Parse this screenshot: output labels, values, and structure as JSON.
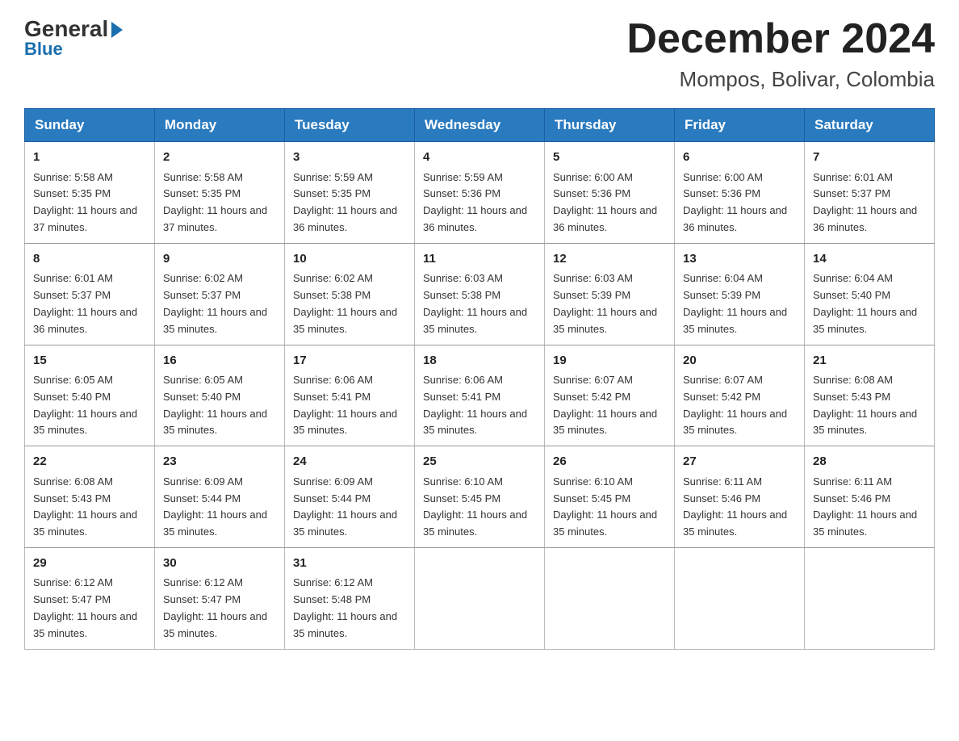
{
  "header": {
    "logo_general": "General",
    "logo_blue": "Blue",
    "month_title": "December 2024",
    "location": "Mompos, Bolivar, Colombia"
  },
  "days_of_week": [
    "Sunday",
    "Monday",
    "Tuesday",
    "Wednesday",
    "Thursday",
    "Friday",
    "Saturday"
  ],
  "weeks": [
    [
      {
        "day": "1",
        "sunrise": "5:58 AM",
        "sunset": "5:35 PM",
        "daylight": "11 hours and 37 minutes"
      },
      {
        "day": "2",
        "sunrise": "5:58 AM",
        "sunset": "5:35 PM",
        "daylight": "11 hours and 37 minutes"
      },
      {
        "day": "3",
        "sunrise": "5:59 AM",
        "sunset": "5:35 PM",
        "daylight": "11 hours and 36 minutes"
      },
      {
        "day": "4",
        "sunrise": "5:59 AM",
        "sunset": "5:36 PM",
        "daylight": "11 hours and 36 minutes"
      },
      {
        "day": "5",
        "sunrise": "6:00 AM",
        "sunset": "5:36 PM",
        "daylight": "11 hours and 36 minutes"
      },
      {
        "day": "6",
        "sunrise": "6:00 AM",
        "sunset": "5:36 PM",
        "daylight": "11 hours and 36 minutes"
      },
      {
        "day": "7",
        "sunrise": "6:01 AM",
        "sunset": "5:37 PM",
        "daylight": "11 hours and 36 minutes"
      }
    ],
    [
      {
        "day": "8",
        "sunrise": "6:01 AM",
        "sunset": "5:37 PM",
        "daylight": "11 hours and 36 minutes"
      },
      {
        "day": "9",
        "sunrise": "6:02 AM",
        "sunset": "5:37 PM",
        "daylight": "11 hours and 35 minutes"
      },
      {
        "day": "10",
        "sunrise": "6:02 AM",
        "sunset": "5:38 PM",
        "daylight": "11 hours and 35 minutes"
      },
      {
        "day": "11",
        "sunrise": "6:03 AM",
        "sunset": "5:38 PM",
        "daylight": "11 hours and 35 minutes"
      },
      {
        "day": "12",
        "sunrise": "6:03 AM",
        "sunset": "5:39 PM",
        "daylight": "11 hours and 35 minutes"
      },
      {
        "day": "13",
        "sunrise": "6:04 AM",
        "sunset": "5:39 PM",
        "daylight": "11 hours and 35 minutes"
      },
      {
        "day": "14",
        "sunrise": "6:04 AM",
        "sunset": "5:40 PM",
        "daylight": "11 hours and 35 minutes"
      }
    ],
    [
      {
        "day": "15",
        "sunrise": "6:05 AM",
        "sunset": "5:40 PM",
        "daylight": "11 hours and 35 minutes"
      },
      {
        "day": "16",
        "sunrise": "6:05 AM",
        "sunset": "5:40 PM",
        "daylight": "11 hours and 35 minutes"
      },
      {
        "day": "17",
        "sunrise": "6:06 AM",
        "sunset": "5:41 PM",
        "daylight": "11 hours and 35 minutes"
      },
      {
        "day": "18",
        "sunrise": "6:06 AM",
        "sunset": "5:41 PM",
        "daylight": "11 hours and 35 minutes"
      },
      {
        "day": "19",
        "sunrise": "6:07 AM",
        "sunset": "5:42 PM",
        "daylight": "11 hours and 35 minutes"
      },
      {
        "day": "20",
        "sunrise": "6:07 AM",
        "sunset": "5:42 PM",
        "daylight": "11 hours and 35 minutes"
      },
      {
        "day": "21",
        "sunrise": "6:08 AM",
        "sunset": "5:43 PM",
        "daylight": "11 hours and 35 minutes"
      }
    ],
    [
      {
        "day": "22",
        "sunrise": "6:08 AM",
        "sunset": "5:43 PM",
        "daylight": "11 hours and 35 minutes"
      },
      {
        "day": "23",
        "sunrise": "6:09 AM",
        "sunset": "5:44 PM",
        "daylight": "11 hours and 35 minutes"
      },
      {
        "day": "24",
        "sunrise": "6:09 AM",
        "sunset": "5:44 PM",
        "daylight": "11 hours and 35 minutes"
      },
      {
        "day": "25",
        "sunrise": "6:10 AM",
        "sunset": "5:45 PM",
        "daylight": "11 hours and 35 minutes"
      },
      {
        "day": "26",
        "sunrise": "6:10 AM",
        "sunset": "5:45 PM",
        "daylight": "11 hours and 35 minutes"
      },
      {
        "day": "27",
        "sunrise": "6:11 AM",
        "sunset": "5:46 PM",
        "daylight": "11 hours and 35 minutes"
      },
      {
        "day": "28",
        "sunrise": "6:11 AM",
        "sunset": "5:46 PM",
        "daylight": "11 hours and 35 minutes"
      }
    ],
    [
      {
        "day": "29",
        "sunrise": "6:12 AM",
        "sunset": "5:47 PM",
        "daylight": "11 hours and 35 minutes"
      },
      {
        "day": "30",
        "sunrise": "6:12 AM",
        "sunset": "5:47 PM",
        "daylight": "11 hours and 35 minutes"
      },
      {
        "day": "31",
        "sunrise": "6:12 AM",
        "sunset": "5:48 PM",
        "daylight": "11 hours and 35 minutes"
      },
      null,
      null,
      null,
      null
    ]
  ]
}
